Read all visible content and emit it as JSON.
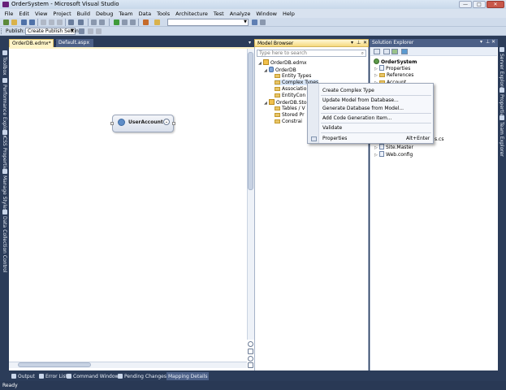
{
  "window": {
    "title": "OrderSystem - Microsoft Visual Studio",
    "minimize": "—",
    "maximize": "□",
    "close": "✕"
  },
  "menu": [
    "File",
    "Edit",
    "View",
    "Project",
    "Build",
    "Debug",
    "Team",
    "Data",
    "Tools",
    "Architecture",
    "Test",
    "Analyze",
    "Window",
    "Help"
  ],
  "toolbar": {
    "publish_label": "Publish:",
    "publish_value": "Create Publish Settings",
    "solution_config_value": ""
  },
  "left_tools": [
    "Toolbox",
    "Performance Explorer",
    "CSS Properties",
    "Manage Styles",
    "Data Collection Control"
  ],
  "right_tools": [
    "Server Explorer",
    "Properties",
    "Team Explorer"
  ],
  "doc_tabs": [
    {
      "label": "OrderDB.edmx*",
      "active": true
    },
    {
      "label": "Default.aspx",
      "active": false
    }
  ],
  "designer": {
    "entity_name": "UserAccount"
  },
  "model_browser": {
    "title": "Model Browser",
    "search_placeholder": "Type here to search",
    "tree": {
      "root": "OrderDB.edmx",
      "model": "OrderDB",
      "model_children": [
        "Entity Types",
        "Complex Types",
        "Associatio",
        "EntityCon"
      ],
      "store": "OrderDB.Stor",
      "store_children": [
        "Tables / V",
        "Stored Pr",
        "Constrai"
      ]
    }
  },
  "context_menu": {
    "items": [
      "Create Complex Type",
      "Update Model from Database...",
      "Generate Database from Model...",
      "Add Code Generation Item...",
      "Validate",
      "Properties"
    ],
    "properties_shortcut": "Alt+Enter"
  },
  "solution_explorer": {
    "title": "Solution Explorer",
    "project": "OrderSystem",
    "items": [
      "Properties",
      "References",
      "Account"
    ],
    "partial_item": "s.cs",
    "lower_items": [
      "Site.Master",
      "Web.config"
    ]
  },
  "bottom_tabs": [
    "Output",
    "Error List",
    "Command Window",
    "Pending Changes",
    "Mapping Details"
  ],
  "status": {
    "text": "Ready"
  },
  "colors": {
    "chrome": "#2b3c59",
    "active_tab": "#fef4c8",
    "panel_header": "#4c6087"
  }
}
